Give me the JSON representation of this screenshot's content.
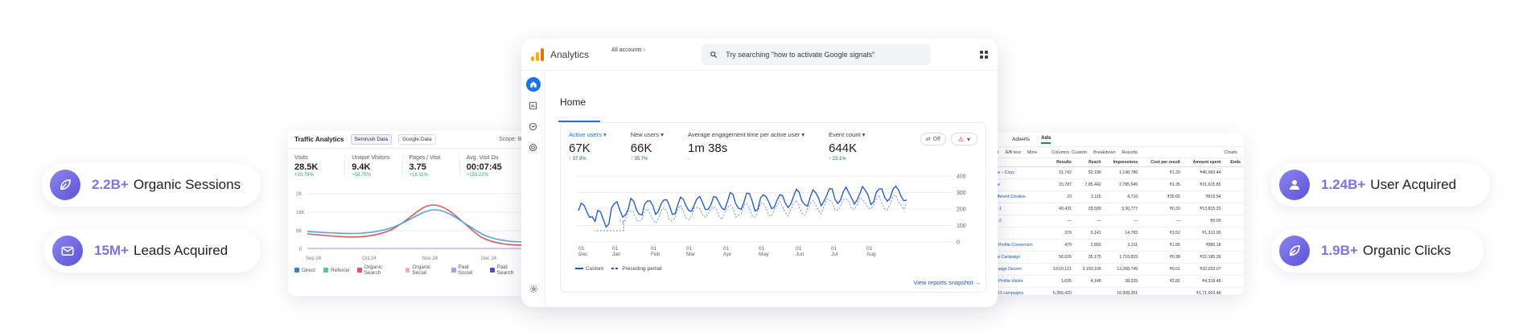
{
  "stats_left": [
    {
      "value": "2.2B+",
      "label": "Organic Sessions",
      "icon": "leaf-icon"
    },
    {
      "value": "15M+",
      "label": "Leads Acquired",
      "icon": "mail-icon"
    }
  ],
  "stats_right": [
    {
      "value": "1.24B+",
      "label": "User Acquired",
      "icon": "user-icon"
    },
    {
      "value": "1.9B+",
      "label": "Organic Clicks",
      "icon": "leaf-icon"
    }
  ],
  "traffic": {
    "title": "Traffic Analytics",
    "tab_semrush": "Semrush Data",
    "tab_google": "Google Data",
    "scope": "Scope: Bl",
    "metrics": [
      {
        "label": "Visits",
        "value": "28.5K",
        "delta": "+20.79%"
      },
      {
        "label": "Unique Visitors",
        "value": "9.4K",
        "delta": "+58.75%"
      },
      {
        "label": "Pages / Visit",
        "value": "3.75",
        "delta": "+18.11%"
      },
      {
        "label": "Avg. Visit Du",
        "value": "00:07:45",
        "delta": "+153.22%"
      }
    ],
    "yticks": [
      "2K",
      "16K",
      "8K",
      "0"
    ],
    "xticks": [
      "Sep 24",
      "Oct 24",
      "Nov 24",
      "Dec 24"
    ],
    "legend": [
      "Direct",
      "Referral",
      "Organic Search",
      "Organic Social",
      "Paid Social",
      "Paid Search"
    ],
    "legend_colors": [
      "#3a7bd5",
      "#53c29a",
      "#e0555e",
      "#f3a8c4",
      "#b89be6",
      "#6c3fb8"
    ]
  },
  "analytics": {
    "app_name": "Analytics",
    "accounts": "All accounts",
    "search_placeholder": "Try searching \"how to activate Google signals\"",
    "home_title": "Home",
    "kpis": [
      {
        "label": "Active users",
        "value": "67K",
        "delta": "↑ 37.9%"
      },
      {
        "label": "New users",
        "value": "66K",
        "delta": "↑ 35.7%"
      },
      {
        "label": "Average engagement time per active user",
        "value": "1m 38s",
        "delta": "-"
      },
      {
        "label": "Event count",
        "value": "644K",
        "delta": "↑ 23.1%"
      }
    ],
    "compare_chip": "Off",
    "y_ticks": [
      "400",
      "300",
      "200",
      "100",
      "0"
    ],
    "x_ticks": [
      {
        "day": "01",
        "month": "Dec"
      },
      {
        "day": "01",
        "month": "Jan"
      },
      {
        "day": "01",
        "month": "Feb"
      },
      {
        "day": "01",
        "month": "Mar"
      },
      {
        "day": "01",
        "month": "Apr"
      },
      {
        "day": "01",
        "month": "May"
      },
      {
        "day": "01",
        "month": "Jun"
      },
      {
        "day": "01",
        "month": "Jul"
      },
      {
        "day": "01",
        "month": "Aug"
      }
    ],
    "legend_custom": "Custom",
    "legend_preceding": "Preceding period",
    "link": "View reports snapshot →"
  },
  "ads": {
    "tabs": [
      "Adverts",
      "Ads"
    ],
    "toolbar": [
      "Edit",
      "A/B test",
      "More",
      "Columns: Custom",
      "Breakdown",
      "Reports",
      "Charts"
    ],
    "columns": [
      "Ad",
      "Results",
      "Reach",
      "Impressions",
      "Cost per result",
      "Amount spent",
      "Ends"
    ],
    "rows": [
      [
        "Follow – Copy",
        "31,742",
        "52,190",
        "1,148,786",
        "₹1.29",
        "₹40,983.44",
        ""
      ],
      [
        "Follow",
        "15,787",
        "7,85,442",
        "2,785,545",
        "₹1.35",
        "₹21,615.85",
        ""
      ],
      [
        "— Different Creative",
        "23",
        "2,115",
        "4,716",
        "₹35.65",
        "₹819.54",
        ""
      ],
      [
        "Page-1",
        "40,431",
        "28,590",
        "3,30,777",
        "₹0.33",
        "₹13,815.33",
        ""
      ],
      [
        "Page-2",
        "—",
        "—",
        "—",
        "—",
        "₹0.00",
        ""
      ],
      [
        "1",
        "379",
        "5,141",
        "14,783",
        "₹3.52",
        "₹1,313.95",
        ""
      ],
      [
        "Insta-Profile-Conversion",
        "479",
        "2,893",
        "2,311",
        "₹1.85",
        "₹985.18",
        ""
      ],
      [
        "Follow Campaign",
        "58,626",
        "35,175",
        "1,718,815",
        "₹0.38",
        "₹22,185.39",
        ""
      ],
      [
        "Campaign Decem",
        "3,510,121",
        "3,150,105",
        "13,268,745",
        "₹0.01",
        "₹32,293.07",
        ""
      ],
      [
        "Insta-Profile-Visitor",
        "1,635",
        "4,148",
        "38,325",
        "₹2.81",
        "₹4,318.48",
        ""
      ],
      [
        "from 13 campaigns",
        "6,356,420",
        "",
        "16,308,351",
        "",
        "₹1,71,603.48",
        ""
      ]
    ]
  }
}
